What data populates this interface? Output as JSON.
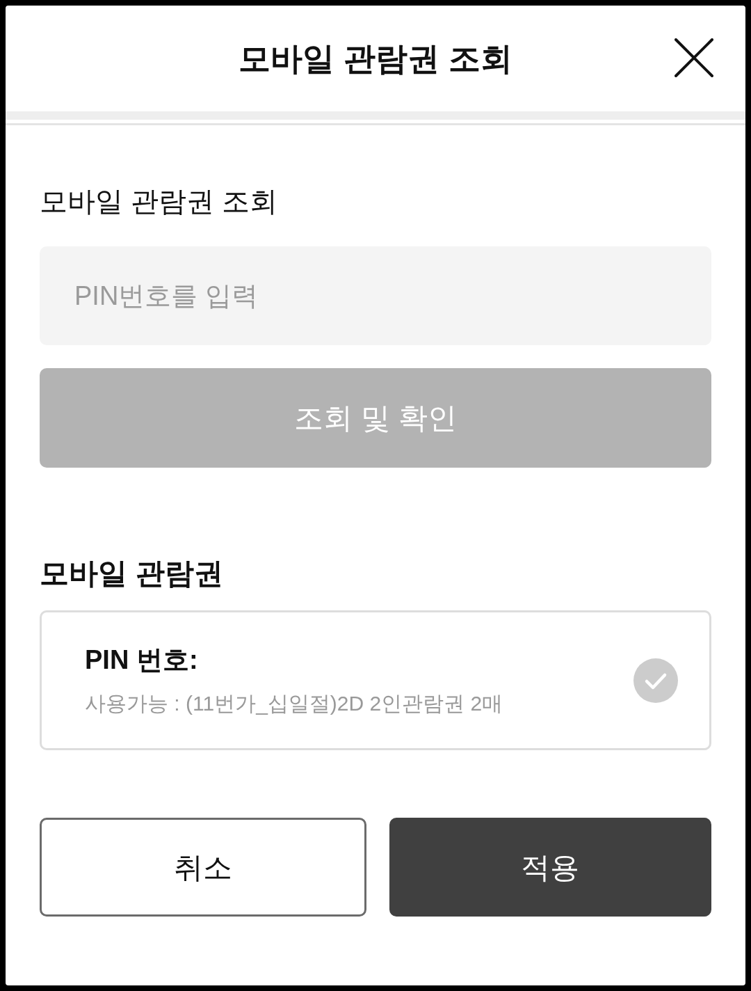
{
  "dialog": {
    "title": "모바일 관람권 조회"
  },
  "lookup": {
    "label": "모바일 관람권 조회",
    "pin_field": {
      "placeholder": "PIN번호를 입력"
    },
    "button": {
      "label": "조회 및 확인",
      "disabled": true
    }
  },
  "tickets": {
    "heading": "모바일 관람권",
    "items": [
      {
        "pin_label": "PIN 번호:",
        "status": "사용가능 : (11번가_십일절)2D 2인관람권 2매",
        "selected": false
      }
    ]
  },
  "footer_buttons": [
    {
      "label": "취소",
      "kind": "secondary"
    },
    {
      "label": "적용",
      "kind": "primary"
    }
  ]
}
